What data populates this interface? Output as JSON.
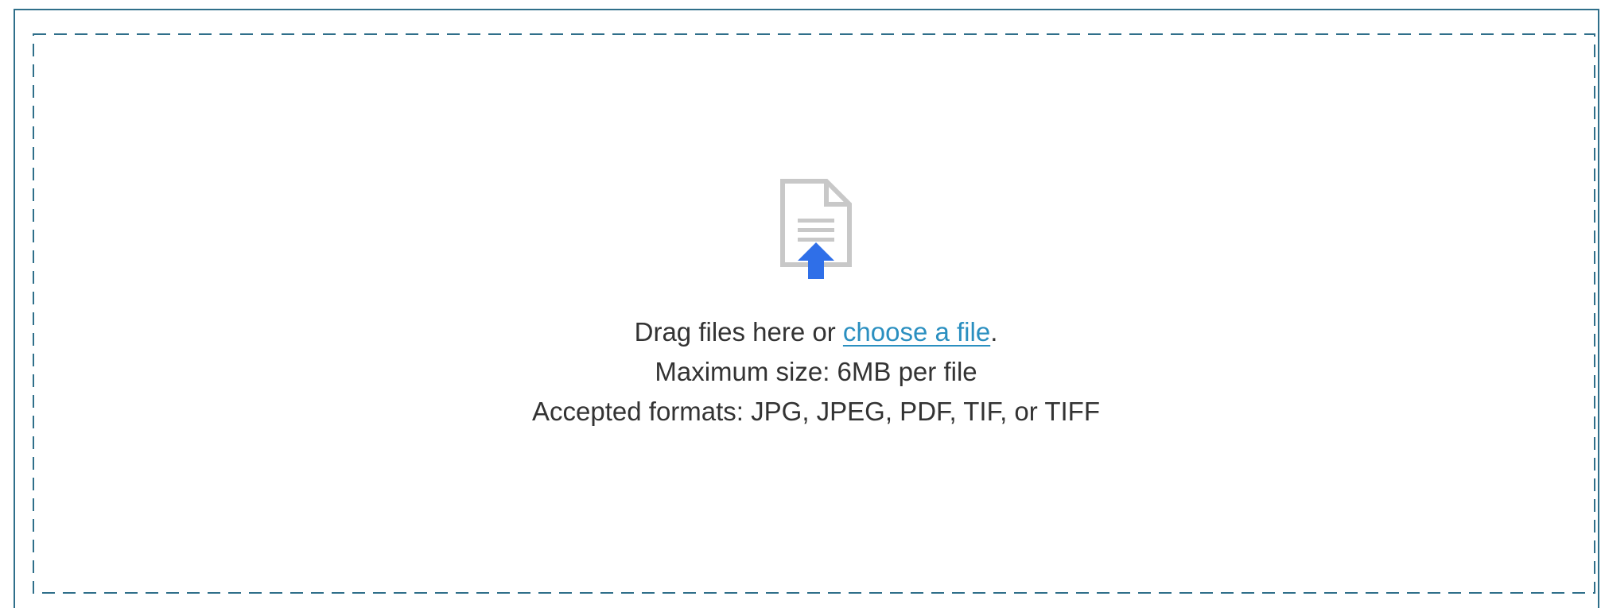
{
  "upload": {
    "instruction_prefix": "Drag files here or ",
    "link_label": "choose a file",
    "instruction_suffix": ".",
    "max_size": "Maximum size: 6MB per file",
    "accepted_formats": "Accepted formats: JPG, JPEG, PDF, TIF, or TIFF",
    "icon": "file-upload-icon"
  },
  "colors": {
    "panel_border": "#2f6f8a",
    "dashed_border": "#2f6f8a",
    "link": "#2a8fc0",
    "icon_gray": "#c8c8c8",
    "icon_arrow": "#2f6fe8",
    "text": "#333333"
  }
}
